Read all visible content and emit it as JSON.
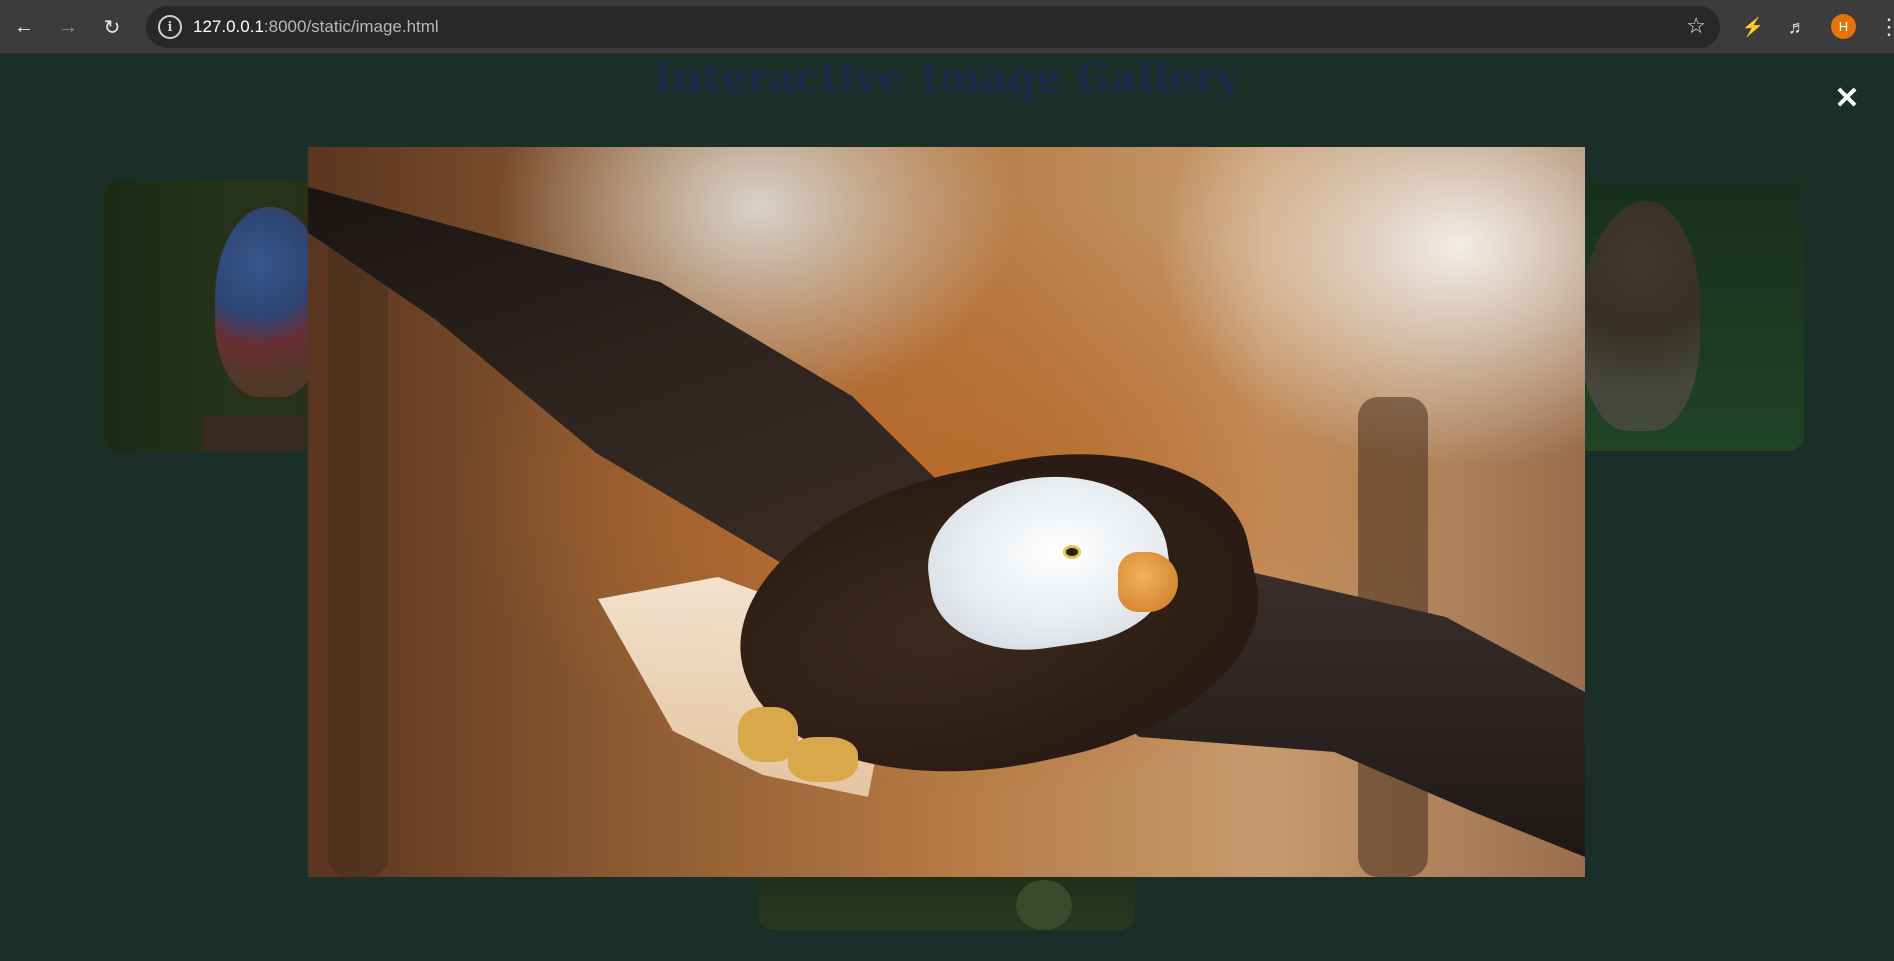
{
  "browser": {
    "url_host": "127.0.0.1",
    "url_rest": ":8000/static/image.html",
    "profile_initial": "H",
    "icons": [
      "back-icon",
      "forward-icon",
      "reload-icon",
      "site-info-icon",
      "bookmark-star-icon",
      "performance-icon",
      "media-controls-icon",
      "profile-avatar",
      "more-menu-icon"
    ]
  },
  "page": {
    "title": "Interactive Image Gallery"
  },
  "gallery": {
    "cards": [
      {
        "subject": "parrot"
      },
      {
        "subject": "hawk"
      },
      {
        "subject": "pears"
      }
    ]
  },
  "lightbox": {
    "open": true,
    "close_symbol": "✕",
    "image_subject": "bald eagle in flight"
  },
  "colors": {
    "page_background": "#1a2f28",
    "title_color": "#1c2a4a",
    "chrome_background": "#3c3c3c",
    "avatar": "#e8710a"
  }
}
